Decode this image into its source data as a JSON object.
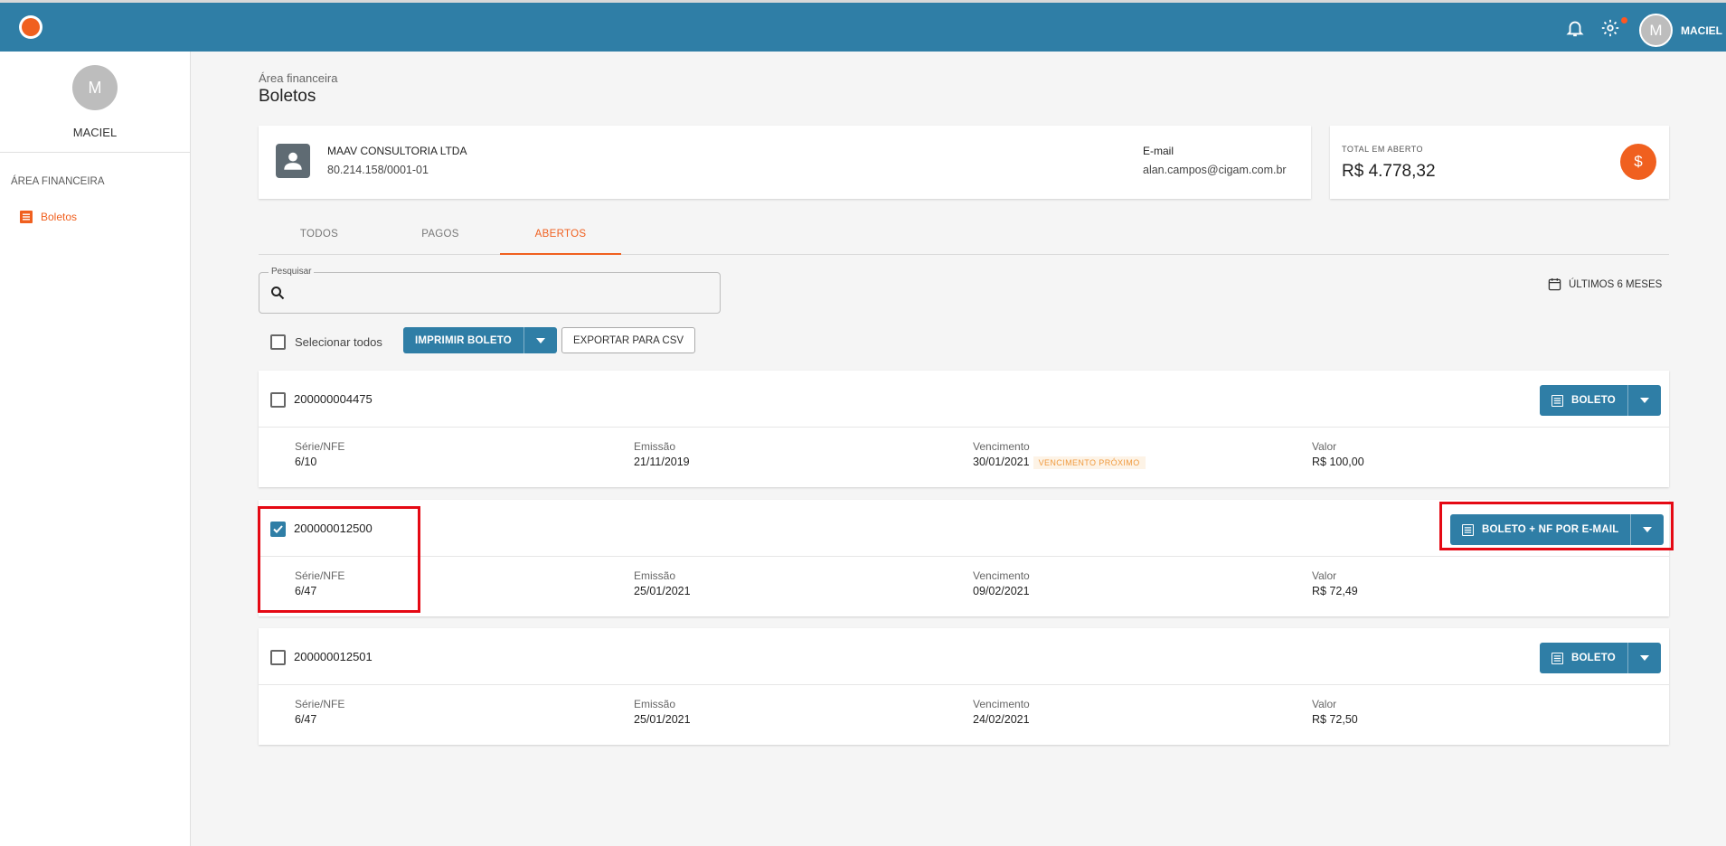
{
  "topbar": {
    "user_initial": "M",
    "user_name": "MACIEL"
  },
  "sidebar": {
    "user_initial": "M",
    "user_name": "MACIEL",
    "section_title": "ÁREA FINANCEIRA",
    "items": [
      {
        "label": "Boletos",
        "icon": "list-icon",
        "active": true
      }
    ]
  },
  "page": {
    "breadcrumb": "Área financeira",
    "title": "Boletos"
  },
  "company": {
    "name": "MAAV CONSULTORIA LTDA",
    "cnpj": "80.214.158/0001-01",
    "email_label": "E-mail",
    "email": "alan.campos@cigam.com.br"
  },
  "total": {
    "label": "TOTAL EM ABERTO",
    "value": "R$ 4.778,32",
    "icon": "dollar-icon"
  },
  "tabs": [
    {
      "label": "TODOS",
      "active": false
    },
    {
      "label": "PAGOS",
      "active": false
    },
    {
      "label": "ABERTOS",
      "active": true
    }
  ],
  "search": {
    "label": "Pesquisar",
    "value": ""
  },
  "period": {
    "label": "ÚLTIMOS 6 MESES"
  },
  "actions": {
    "select_all": "Selecionar todos",
    "print": "IMPRIMIR BOLETO",
    "export": "EXPORTAR PARA CSV"
  },
  "field_labels": {
    "serie": "Série/NFE",
    "emissao": "Emissão",
    "vencimento": "Vencimento",
    "valor": "Valor"
  },
  "invoices": [
    {
      "number": "200000004475",
      "checked": false,
      "button": "BOLETO",
      "serie": "6/10",
      "emissao": "21/11/2019",
      "vencimento": "30/01/2021",
      "badge": "VENCIMENTO PRÓXIMO",
      "valor": "R$ 100,00"
    },
    {
      "number": "200000012500",
      "checked": true,
      "button": "BOLETO + NF POR E-MAIL",
      "serie": "6/47",
      "emissao": "25/01/2021",
      "vencimento": "09/02/2021",
      "valor": "R$ 72,49"
    },
    {
      "number": "200000012501",
      "checked": false,
      "button": "BOLETO",
      "serie": "6/47",
      "emissao": "25/01/2021",
      "vencimento": "24/02/2021",
      "valor": "R$ 72,50"
    }
  ],
  "colors": {
    "primary": "#2f7ea6",
    "accent": "#f0601f",
    "highlight": "#e50914"
  }
}
